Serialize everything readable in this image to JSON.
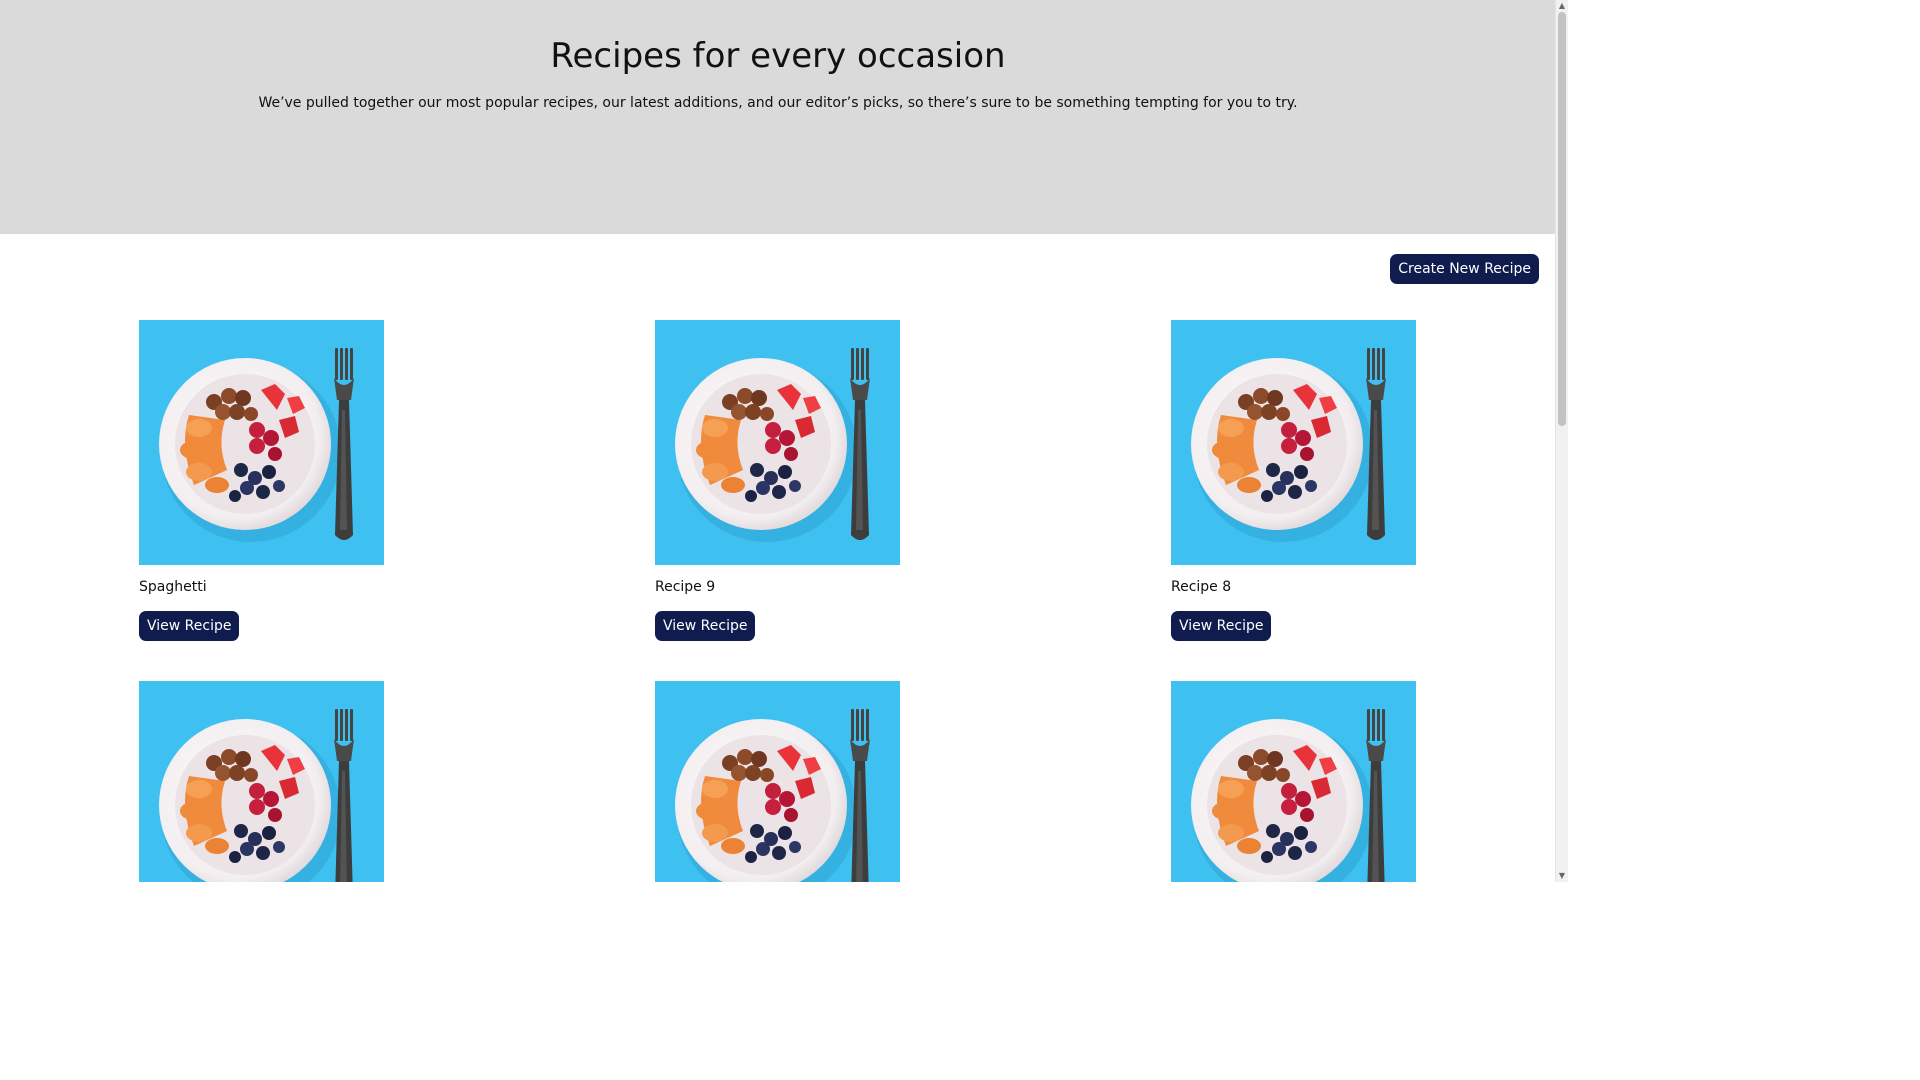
{
  "hero": {
    "title": "Recipes for every occasion",
    "subtitle": "We’ve pulled together our most popular recipes, our latest additions, and our editor’s picks, so there’s sure to be something tempting for you to try."
  },
  "toolbar": {
    "create_label": "Create New Recipe"
  },
  "recipes": [
    {
      "name": "Spaghetti",
      "button": "View Recipe"
    },
    {
      "name": "Recipe 9",
      "button": "View Recipe"
    },
    {
      "name": "Recipe 8",
      "button": "View Recipe"
    },
    {
      "name": "",
      "button": ""
    },
    {
      "name": "",
      "button": ""
    },
    {
      "name": "",
      "button": ""
    }
  ],
  "image": {
    "icon": "fruit-bowl-image",
    "background_color": "#3ec0f0"
  },
  "colors": {
    "button": "#0f1c4d",
    "hero_background": "#dadada"
  }
}
